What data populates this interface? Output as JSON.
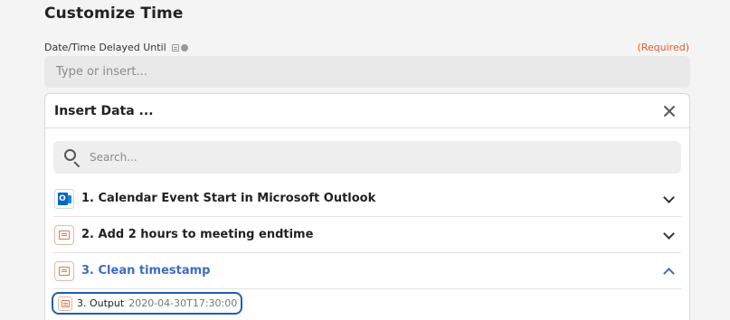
{
  "section": {
    "title": "Customize Time"
  },
  "field": {
    "label": "Date/Time Delayed Until",
    "required": "(Required)",
    "placeholder": "Type or insert..."
  },
  "panel": {
    "title": "Insert Data ...",
    "search_placeholder": "Search...",
    "steps": [
      {
        "label": "1. Calendar Event Start in Microsoft Outlook",
        "icon": "outlook-icon",
        "expanded": false
      },
      {
        "label": "2. Add 2 hours to meeting endtime",
        "icon": "formatter-icon",
        "expanded": false
      },
      {
        "label": "3. Clean timestamp",
        "icon": "formatter-icon",
        "expanded": true
      }
    ],
    "output": {
      "key": "3. Output",
      "value": "2020-04-30T17:30:00"
    }
  },
  "colors": {
    "accent": "#3d6cc4",
    "required": "#d9602b",
    "formatter": "#e0774a",
    "outlook": "#0a64c4"
  }
}
